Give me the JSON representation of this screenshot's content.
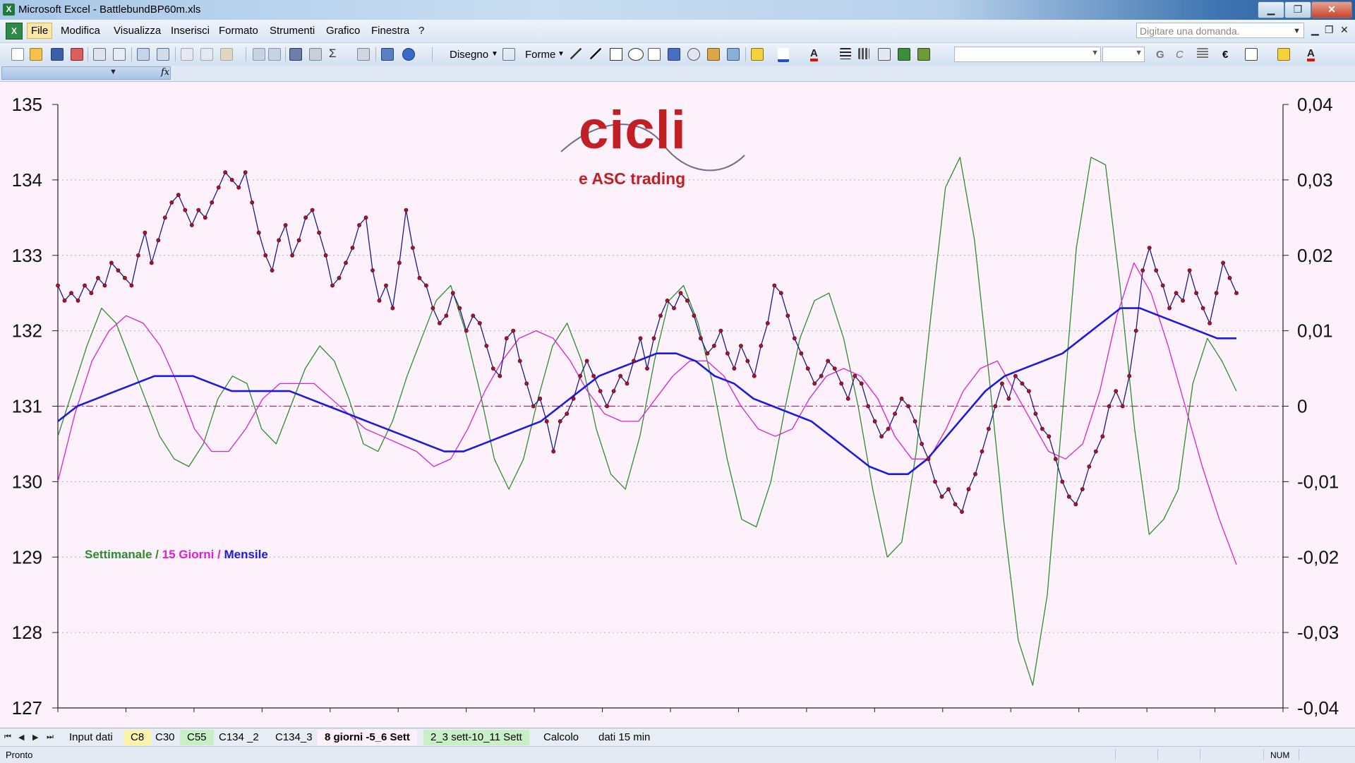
{
  "window": {
    "title": "Microsoft Excel - BattlebundBP60m.xls",
    "app_icon": "X"
  },
  "window_buttons": [
    "minimize-icon",
    "restore-icon",
    "close-icon"
  ],
  "menu": {
    "items": [
      "File",
      "Modifica",
      "Visualizza",
      "Inserisci",
      "Formato",
      "Strumenti",
      "Grafico",
      "Finestra",
      "?"
    ],
    "active": "File",
    "ask_placeholder": "Digitare una domanda."
  },
  "toolbar": {
    "draw_label": "Disegno",
    "shapes_label": "Forme",
    "bold": "G",
    "italic": "C",
    "euro": "€",
    "sigma": "Σ",
    "fx": "fx"
  },
  "chart_data": {
    "type": "line",
    "logo": {
      "main": "cicli",
      "sub": "e ASC trading"
    },
    "legend": [
      {
        "text": "Settimanale",
        "color": "#2e8b2e"
      },
      {
        "text": " / ",
        "color": "#2e8b2e"
      },
      {
        "text": "15 Giorni",
        "color": "#e020d0"
      },
      {
        "text": " / ",
        "color": "#e020d0"
      },
      {
        "text": "Mensile",
        "color": "#1a1ae0"
      }
    ],
    "y_left": {
      "ticks": [
        "135",
        "134",
        "133",
        "132",
        "131",
        "130",
        "129",
        "128",
        "127"
      ],
      "min": 127,
      "max": 135
    },
    "y_right": {
      "ticks": [
        "0,04",
        "0,03",
        "0,02",
        "0,01",
        "0",
        "-0,01",
        "-0,02",
        "-0,03",
        "-0,04"
      ],
      "min": -0.04,
      "max": 0.04
    },
    "x_range": [
      0,
      180
    ],
    "grid": "horizontal dotted",
    "price_series": {
      "color": "#1a1a8a",
      "marker_color": "#b0102c",
      "values": [
        132.6,
        132.4,
        132.5,
        132.4,
        132.6,
        132.5,
        132.7,
        132.6,
        132.9,
        132.8,
        132.7,
        132.6,
        133.0,
        133.3,
        132.9,
        133.2,
        133.5,
        133.7,
        133.8,
        133.6,
        133.4,
        133.6,
        133.5,
        133.7,
        133.9,
        134.1,
        134.0,
        133.9,
        134.1,
        133.7,
        133.3,
        133.0,
        132.8,
        133.2,
        133.4,
        133.0,
        133.2,
        133.5,
        133.6,
        133.3,
        133.0,
        132.6,
        132.7,
        132.9,
        133.1,
        133.4,
        133.5,
        132.8,
        132.4,
        132.6,
        132.3,
        132.9,
        133.6,
        133.1,
        132.7,
        132.6,
        132.3,
        132.1,
        132.2,
        132.5,
        132.3,
        132.0,
        132.2,
        132.1,
        131.8,
        131.5,
        131.4,
        131.9,
        132.0,
        131.6,
        131.3,
        131.0,
        131.1,
        130.8,
        130.4,
        130.8,
        130.9,
        131.1,
        131.4,
        131.6,
        131.4,
        131.2,
        131.0,
        131.2,
        131.4,
        131.3,
        131.6,
        131.9,
        131.5,
        131.9,
        132.2,
        132.4,
        132.3,
        132.5,
        132.4,
        132.2,
        131.9,
        131.7,
        131.8,
        132.0,
        131.7,
        131.5,
        131.8,
        131.6,
        131.4,
        131.8,
        132.1,
        132.6,
        132.5,
        132.2,
        131.9,
        131.7,
        131.5,
        131.3,
        131.4,
        131.6,
        131.5,
        131.3,
        131.1,
        131.4,
        131.3,
        131.0,
        130.8,
        130.6,
        130.7,
        130.9,
        131.1,
        131.0,
        130.8,
        130.5,
        130.3,
        130.0,
        129.8,
        129.9,
        129.7,
        129.6,
        129.9,
        130.1,
        130.4,
        130.7,
        131.0,
        131.3,
        131.1,
        131.4,
        131.3,
        131.2,
        130.9,
        130.7,
        130.6,
        130.3,
        130.0,
        129.8,
        129.7,
        129.9,
        130.2,
        130.4,
        130.6,
        131.0,
        131.2,
        131.0,
        131.4,
        132.0,
        132.8,
        133.1,
        132.8,
        132.6,
        132.3,
        132.5,
        132.4,
        132.8,
        132.5,
        132.3,
        132.1,
        132.5,
        132.9,
        132.7,
        132.5
      ]
    },
    "weekly_series": {
      "color": "#2e8b2e",
      "values": [
        -0.004,
        0.002,
        0.008,
        0.013,
        0.011,
        0.006,
        0.001,
        -0.004,
        -0.007,
        -0.008,
        -0.005,
        0.001,
        0.004,
        0.003,
        -0.003,
        -0.005,
        0.0,
        0.005,
        0.008,
        0.006,
        0.001,
        -0.005,
        -0.006,
        -0.002,
        0.004,
        0.009,
        0.014,
        0.016,
        0.01,
        0.002,
        -0.007,
        -0.011,
        -0.007,
        0.001,
        0.008,
        0.011,
        0.006,
        -0.003,
        -0.009,
        -0.011,
        -0.004,
        0.006,
        0.014,
        0.016,
        0.011,
        0.003,
        -0.007,
        -0.015,
        -0.016,
        -0.01,
        0.0,
        0.009,
        0.014,
        0.015,
        0.009,
        0.0,
        -0.011,
        -0.02,
        -0.018,
        -0.006,
        0.012,
        0.029,
        0.033,
        0.022,
        0.004,
        -0.015,
        -0.031,
        -0.037,
        -0.025,
        -0.002,
        0.021,
        0.033,
        0.032,
        0.016,
        -0.003,
        -0.017,
        -0.015,
        -0.011,
        0.003,
        0.009,
        0.006,
        0.002
      ]
    },
    "fifteen_day_series": {
      "color": "#e020d0",
      "values": [
        -0.01,
        -0.001,
        0.006,
        0.01,
        0.012,
        0.011,
        0.008,
        0.003,
        -0.003,
        -0.006,
        -0.006,
        -0.003,
        0.001,
        0.003,
        0.003,
        0.003,
        0.001,
        -0.001,
        -0.003,
        -0.004,
        -0.005,
        -0.006,
        -0.008,
        -0.007,
        -0.003,
        0.002,
        0.006,
        0.009,
        0.01,
        0.009,
        0.006,
        0.002,
        -0.001,
        -0.002,
        -0.002,
        0.001,
        0.004,
        0.006,
        0.006,
        0.004,
        0.0,
        -0.003,
        -0.004,
        -0.003,
        0.001,
        0.004,
        0.005,
        0.004,
        0.001,
        -0.004,
        -0.007,
        -0.007,
        -0.003,
        0.002,
        0.005,
        0.006,
        0.002,
        -0.002,
        -0.006,
        -0.007,
        -0.005,
        0.002,
        0.012,
        0.019,
        0.015,
        0.008,
        0.0,
        -0.008,
        -0.015,
        -0.021
      ]
    },
    "monthly_series": {
      "color": "#1a1ae0",
      "values": [
        -0.002,
        0.0,
        0.001,
        0.002,
        0.003,
        0.004,
        0.004,
        0.004,
        0.003,
        0.002,
        0.002,
        0.002,
        0.002,
        0.001,
        0.0,
        -0.001,
        -0.002,
        -0.003,
        -0.004,
        -0.005,
        -0.006,
        -0.006,
        -0.005,
        -0.004,
        -0.003,
        -0.002,
        0.0,
        0.002,
        0.004,
        0.005,
        0.006,
        0.007,
        0.007,
        0.006,
        0.004,
        0.003,
        0.001,
        0.0,
        -0.001,
        -0.002,
        -0.004,
        -0.006,
        -0.008,
        -0.009,
        -0.009,
        -0.007,
        -0.004,
        -0.001,
        0.002,
        0.004,
        0.005,
        0.006,
        0.007,
        0.009,
        0.011,
        0.013,
        0.013,
        0.012,
        0.011,
        0.01,
        0.009,
        0.009
      ]
    }
  },
  "sheet_tabs": [
    {
      "label": "Input dati",
      "style": "plain"
    },
    {
      "label": "C8",
      "style": "yellow"
    },
    {
      "label": "C30",
      "style": "plain"
    },
    {
      "label": "C55",
      "style": "green"
    },
    {
      "label": "C134 _2",
      "style": "plain"
    },
    {
      "label": "C134_3",
      "style": "plain"
    },
    {
      "label": "8 giorni -5_6 Sett",
      "style": "active"
    },
    {
      "label": "2_3 sett-10_11 Sett",
      "style": "green"
    },
    {
      "label": "Calcolo",
      "style": "plain"
    },
    {
      "label": "dati 15 min",
      "style": "plain"
    }
  ],
  "status": {
    "ready": "Pronto",
    "num": "NUM"
  }
}
